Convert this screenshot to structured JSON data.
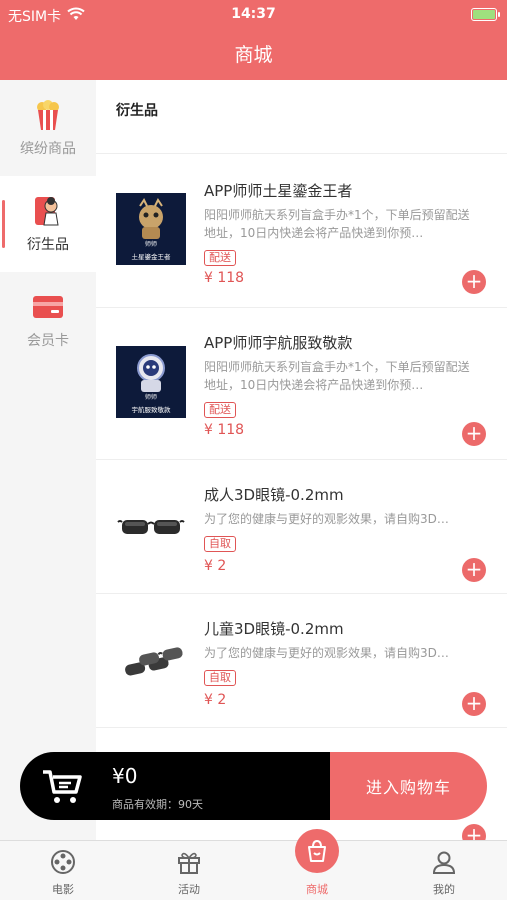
{
  "status": {
    "carrier": "无SIM卡",
    "time": "14:37"
  },
  "header": {
    "title": "商城"
  },
  "sidebar": {
    "items": [
      {
        "label": "缤纷商品",
        "icon": "popcorn-icon",
        "active": false
      },
      {
        "label": "衍生品",
        "icon": "figure-icon",
        "active": true
      },
      {
        "label": "会员卡",
        "icon": "card-icon",
        "active": false
      }
    ]
  },
  "main": {
    "section_title": "衍生品",
    "products": [
      {
        "name": "APP师师土星鎏金王者",
        "desc": "阳阳师师航天系列盲盒手办*1个，下单后预留配送地址，10日内快递会将产品快递到你预…",
        "tag": "配送",
        "price": "¥ 118",
        "thumb_caption": "土星鎏金王者",
        "thumb_label": "师师"
      },
      {
        "name": "APP师师宇航服致敬款",
        "desc": "阳阳师师航天系列盲盒手办*1个，下单后预留配送地址，10日内快递会将产品快递到你预…",
        "tag": "配送",
        "price": "¥ 118",
        "thumb_caption": "宇航服致敬款",
        "thumb_label": "师师"
      },
      {
        "name": "成人3D眼镜-0.2mm",
        "desc": "为了您的健康与更好的观影效果，请自购3D…",
        "tag": "自取",
        "price": "¥ 2"
      },
      {
        "name": "儿童3D眼镜-0.2mm",
        "desc": "为了您的健康与更好的观影效果，请自购3D…",
        "tag": "自取",
        "price": "¥ 2"
      }
    ]
  },
  "cart": {
    "amount": "¥0",
    "validity": "商品有效期：90天",
    "checkout_label": "进入购物车"
  },
  "tabbar": {
    "items": [
      {
        "label": "电影",
        "icon": "film-reel-icon"
      },
      {
        "label": "活动",
        "icon": "gift-icon"
      },
      {
        "label": "商城",
        "icon": "shopping-bag-icon",
        "active": true
      },
      {
        "label": "我的",
        "icon": "user-icon"
      }
    ]
  },
  "colors": {
    "accent": "#ee6b6b",
    "price": "#e05555"
  }
}
